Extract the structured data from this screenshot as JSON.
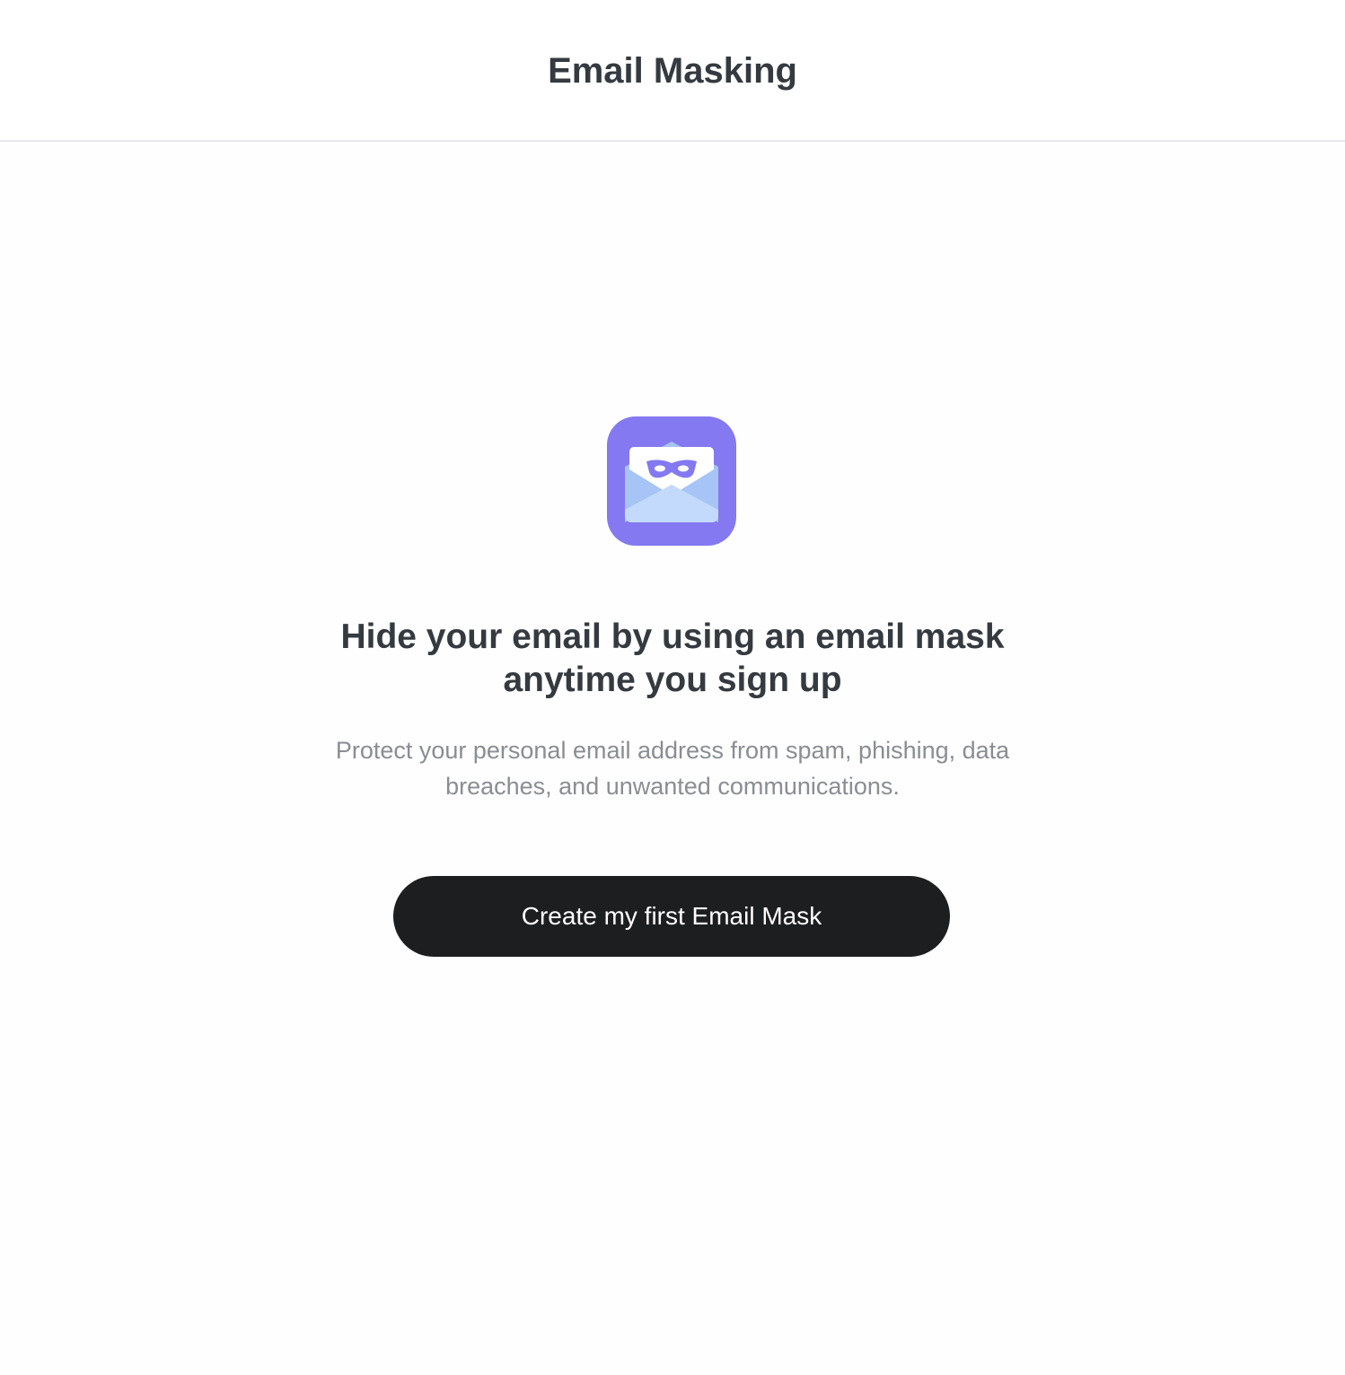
{
  "header": {
    "title": "Email Masking"
  },
  "empty_state": {
    "icon": "email-mask-envelope-icon",
    "headline": "Hide your email by using an email mask anytime you sign up",
    "description": "Protect your personal email address from spam, phishing, data breaches, and unwanted communications.",
    "cta_label": "Create my first Email Mask"
  },
  "colors": {
    "icon_background": "#8479f0",
    "icon_envelope": "#a6c4f5",
    "icon_envelope_front": "#c3dafc",
    "icon_letter": "#ffffff",
    "icon_mask": "#8479f0",
    "button_background": "#1d1e20",
    "heading_text": "#343a40",
    "muted_text": "#8a8d92"
  }
}
